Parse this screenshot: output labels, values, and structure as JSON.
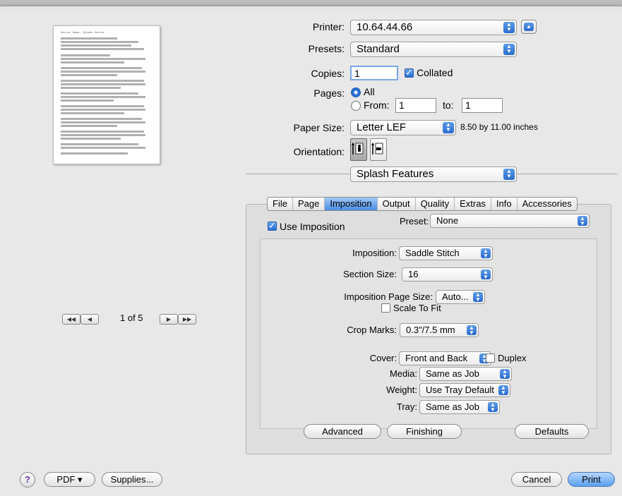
{
  "printer": {
    "label": "Printer:",
    "value": "10.64.44.66"
  },
  "presets": {
    "label": "Presets:",
    "value": "Standard"
  },
  "copies": {
    "label": "Copies:",
    "value": "1",
    "collated_label": "Collated",
    "collated": true
  },
  "pages": {
    "label": "Pages:",
    "all_label": "All",
    "from_label": "From:",
    "from_value": "1",
    "to_label": "to:",
    "to_value": "1",
    "selected": "All"
  },
  "paper_size": {
    "label": "Paper Size:",
    "value": "Letter LEF",
    "dimensions": "8.50 by 11.00 inches"
  },
  "orientation": {
    "label": "Orientation:"
  },
  "section_popup": {
    "value": "Splash Features"
  },
  "tabs": [
    {
      "label": "File",
      "active": false
    },
    {
      "label": "Page",
      "active": false
    },
    {
      "label": "Imposition",
      "active": true
    },
    {
      "label": "Output",
      "active": false
    },
    {
      "label": "Quality",
      "active": false
    },
    {
      "label": "Extras",
      "active": false
    },
    {
      "label": "Info",
      "active": false
    },
    {
      "label": "Accessories",
      "active": false
    }
  ],
  "imposition": {
    "use_label": "Use Imposition",
    "use_checked": true,
    "preset_label": "Preset:",
    "preset_value": "None",
    "imposition_label": "Imposition:",
    "imposition_value": "Saddle Stitch",
    "section_size_label": "Section Size:",
    "section_size_value": "16",
    "page_size_label": "Imposition Page Size:",
    "page_size_value": "Auto...",
    "scale_label": "Scale To Fit",
    "scale_checked": false,
    "crop_label": "Crop Marks:",
    "crop_value": "0.3\"/7.5 mm",
    "cover_label": "Cover:",
    "cover_value": "Front and Back",
    "duplex_label": "Duplex",
    "duplex_checked": false,
    "media_label": "Media:",
    "media_value": "Same as Job",
    "weight_label": "Weight:",
    "weight_value": "Use Tray Default",
    "tray_label": "Tray:",
    "tray_value": "Same as Job"
  },
  "panel_buttons": {
    "advanced": "Advanced",
    "finishing": "Finishing",
    "defaults": "Defaults"
  },
  "preview": {
    "page_indicator": "1 of 5",
    "nav_first": "◀◀",
    "nav_prev": "◀",
    "nav_next": "▶",
    "nav_last": "▶▶"
  },
  "bottom": {
    "help": "?",
    "pdf": "PDF ▾",
    "supplies": "Supplies...",
    "cancel": "Cancel",
    "print": "Print"
  },
  "preview_doc_title": "Server Name: Splash Server",
  "colors": {
    "accent": "#2b6fd6",
    "sheet_bg": "#e8e8e8"
  }
}
